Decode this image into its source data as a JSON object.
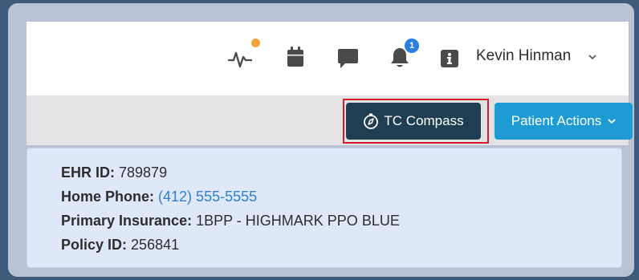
{
  "header": {
    "user_name": "Kevin Hinman",
    "notification_count": "1",
    "colors": {
      "pulse_dot": "#f0a53a",
      "badge": "#2a7fe0",
      "icon": "#4a4a4a"
    }
  },
  "toolbar": {
    "tc_compass_label": "TC Compass",
    "patient_actions_label": "Patient Actions",
    "colors": {
      "tc_compass_bg": "#1f3e52",
      "patient_actions_bg": "#1f9bd3",
      "highlight": "#d21f2b"
    }
  },
  "patient": {
    "fields": [
      {
        "label": "EHR ID:",
        "value": "789879"
      },
      {
        "label": "Home Phone:",
        "value": "(412) 555-5555"
      },
      {
        "label": "Primary Insurance:",
        "value": "1BPP - HIGHMARK PPO BLUE"
      },
      {
        "label": "Policy ID:",
        "value": "256841"
      }
    ],
    "colors": {
      "panel_bg": "#dfe8f9",
      "link": "#2f7ed8"
    }
  }
}
